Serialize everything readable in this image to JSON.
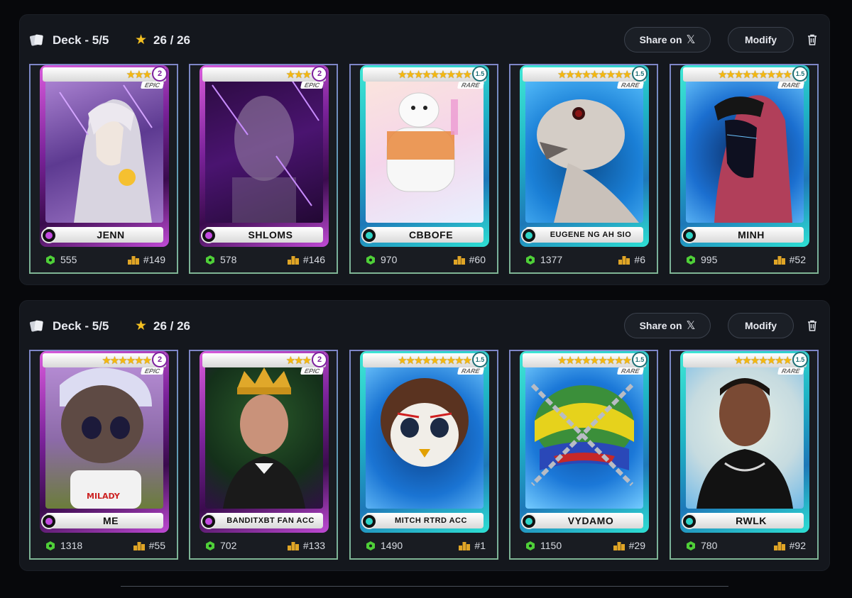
{
  "colors": {
    "accent_star": "#f4c021",
    "score_hex": "#4fcf38",
    "rank_icon": "#e0a526",
    "epic": "#c24ae0",
    "rare": "#2fd3c6"
  },
  "decks": [
    {
      "title": "Deck - 5/5",
      "rating": "26 / 26",
      "share_label": "Share on",
      "share_icon": "x-logo-icon",
      "share_glyph": "𝕏",
      "modify_label": "Modify",
      "cards": [
        {
          "name": "JENN",
          "stars": "★★★",
          "level": "2",
          "rarity": "EPIC",
          "score": "555",
          "rank": "#149"
        },
        {
          "name": "SHLOMS",
          "stars": "★★★",
          "level": "2",
          "rarity": "EPIC",
          "score": "578",
          "rank": "#146"
        },
        {
          "name": "CBBOFE",
          "stars": "★★★★★★★★★",
          "level": "1.5",
          "rarity": "RARE",
          "score": "970",
          "rank": "#60"
        },
        {
          "name": "EUGENE NG AH SIO",
          "stars": "★★★★★★★★★",
          "level": "1.5",
          "rarity": "RARE",
          "score": "1377",
          "rank": "#6"
        },
        {
          "name": "MINH",
          "stars": "★★★★★★★★★",
          "level": "1.5",
          "rarity": "RARE",
          "score": "995",
          "rank": "#52"
        }
      ]
    },
    {
      "title": "Deck - 5/5",
      "rating": "26 / 26",
      "share_label": "Share on",
      "share_icon": "x-logo-icon",
      "share_glyph": "𝕏",
      "modify_label": "Modify",
      "cards": [
        {
          "name": "ME",
          "stars": "★★★★★★",
          "level": "2",
          "rarity": "EPIC",
          "score": "1318",
          "rank": "#55"
        },
        {
          "name": "BANDITXBT FAN ACC",
          "stars": "★★★",
          "level": "2",
          "rarity": "EPIC",
          "score": "702",
          "rank": "#133"
        },
        {
          "name": "MITCH RTRD ACC",
          "stars": "★★★★★★★★★",
          "level": "1.5",
          "rarity": "RARE",
          "score": "1490",
          "rank": "#1"
        },
        {
          "name": "VYDAMO",
          "stars": "★★★★★★★★★",
          "level": "1.5",
          "rarity": "RARE",
          "score": "1150",
          "rank": "#29"
        },
        {
          "name": "RWLK",
          "stars": "★★★★★★★",
          "level": "1.5",
          "rarity": "RARE",
          "score": "780",
          "rank": "#92"
        }
      ]
    }
  ]
}
